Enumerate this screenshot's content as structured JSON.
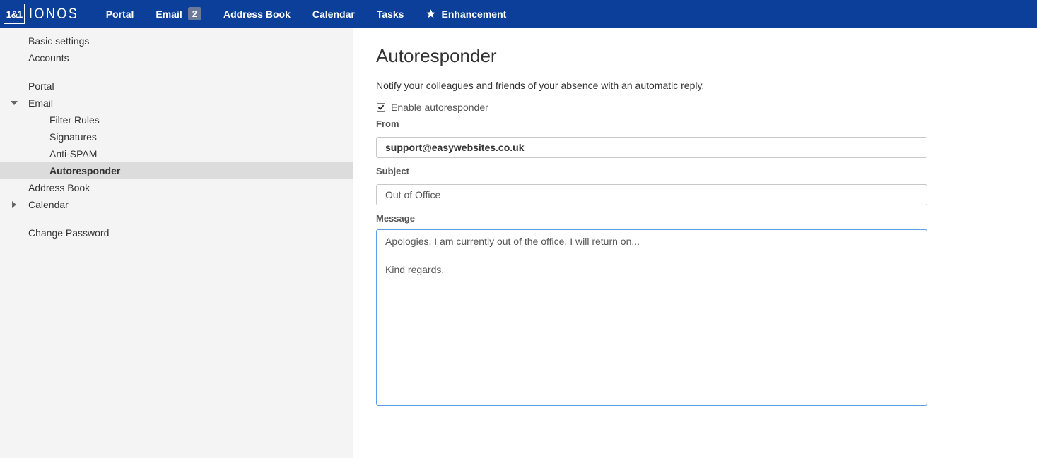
{
  "brand": {
    "logo_box": "1&1",
    "logo_text": "IONOS"
  },
  "topnav": {
    "items": [
      {
        "label": "Portal"
      },
      {
        "label": "Email",
        "badge": "2"
      },
      {
        "label": "Address Book"
      },
      {
        "label": "Calendar"
      },
      {
        "label": "Tasks"
      },
      {
        "label": "Enhancement",
        "icon": "star-icon"
      }
    ]
  },
  "sidebar": {
    "items": [
      {
        "label": "Basic settings",
        "level": 1
      },
      {
        "label": "Accounts",
        "level": 1
      },
      {
        "label": "Portal",
        "level": 1
      },
      {
        "label": "Email",
        "level": 1,
        "expanded": true
      },
      {
        "label": "Filter Rules",
        "level": 2
      },
      {
        "label": "Signatures",
        "level": 2
      },
      {
        "label": "Anti-SPAM",
        "level": 2
      },
      {
        "label": "Autoresponder",
        "level": 2,
        "selected": true
      },
      {
        "label": "Address Book",
        "level": 1
      },
      {
        "label": "Calendar",
        "level": 1,
        "expanded": false
      },
      {
        "label": "Change Password",
        "level": 1
      }
    ]
  },
  "main": {
    "title": "Autoresponder",
    "description": "Notify your colleagues and friends of your absence with an automatic reply.",
    "enable_label": "Enable autoresponder",
    "enable_checked": true,
    "from_label": "From",
    "from_value": "support@easywebsites.co.uk",
    "subject_label": "Subject",
    "subject_value": "Out of Office",
    "message_label": "Message",
    "message_lines": [
      "Apologies, I am currently out of the office. I will return on...",
      "",
      "Kind regards."
    ]
  },
  "colors": {
    "topbar": "#0b3f99",
    "sidebar_bg": "#f4f4f4",
    "selected_bg": "#dcdcdc",
    "focus_border": "#5aa0e8"
  }
}
